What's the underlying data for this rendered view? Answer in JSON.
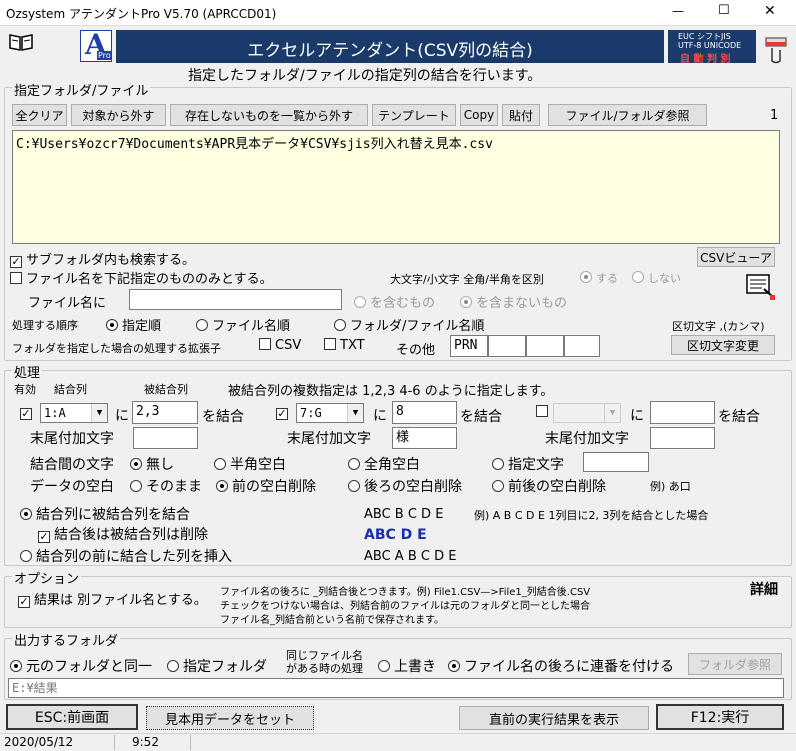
{
  "window": {
    "title": "Ozsystem アテンダントPro V5.70 (APRCCD01)",
    "controls": {
      "min": "—",
      "max": "☐",
      "close": "✕"
    }
  },
  "banner": {
    "title": "エクセルアテンダント(CSV列の結合)",
    "logo_letter": "A",
    "logo_sub": "Pro",
    "encoding_line1": "EUC  シフトJIS",
    "encoding_line2": "UTF-8 UNICODE",
    "encoding_line3": "自 動 判 別",
    "subtitle": "指定したフォルダ/ファイルの指定列の結合を行います。"
  },
  "files": {
    "group_label": "指定フォルダ/ファイル",
    "buttons": [
      "全クリア",
      "対象から外す",
      "存在しないものを一覧から外す",
      "テンプレート",
      "Copy",
      "貼付",
      "ファイル/フォルダ参照"
    ],
    "count": "1",
    "list": [
      "C:¥Users¥ozcr7¥Documents¥APR見本データ¥CSV¥sjis列入れ替え見本.csv"
    ],
    "search_subfolders": "サブフォルダ内も検索する。",
    "filename_filter": "ファイル名を下記指定のもののみとする。",
    "csv_viewer": "CSVビューア",
    "case_label": "大文字/小文字 全角/半角を区別",
    "case_yes": "する",
    "case_no": "しない",
    "filename_label": "ファイル名に",
    "filename_value": "",
    "include": "を含むもの",
    "exclude": "を含まないもの",
    "order_label": "処理する順序",
    "order_specified": "指定順",
    "order_filename": "ファイル名順",
    "order_folder": "フォルダ/ファイル名順",
    "delimiter_label": "区切文字 ,(カンマ)",
    "ext_label": "フォルダを指定した場合の処理する拡張子",
    "ext_csv": "CSV",
    "ext_txt": "TXT",
    "ext_other": "その他",
    "ext_other_values": [
      "PRN",
      "",
      "",
      ""
    ],
    "delimiter_change": "区切文字変更"
  },
  "process": {
    "group_label": "処理",
    "col_enabled": "有効",
    "col_join": "結合列",
    "col_joined": "被結合列",
    "hint": "被結合列の複数指定は  1,2,3   4-6 のように指定します。",
    "rows": [
      {
        "combo": "1:A",
        "ni": "に",
        "target": "2,3",
        "wo": "を結合",
        "suffix_label": "末尾付加文字",
        "suffix": ""
      },
      {
        "combo": "7:G",
        "ni": "に",
        "target": "8",
        "wo": "を結合",
        "suffix_label": "末尾付加文字",
        "suffix": "様"
      },
      {
        "combo": "",
        "ni": "に",
        "target": "",
        "wo": "を結合",
        "suffix_label": "末尾付加文字",
        "suffix": ""
      }
    ],
    "between_label": "結合間の文字",
    "between_none": "無し",
    "between_half": "半角空白",
    "between_full": "全角空白",
    "between_custom": "指定文字",
    "between_custom_value": "",
    "space_label": "データの空白",
    "space_keep": "そのまま",
    "space_front": "前の空白削除",
    "space_back": "後ろの空白削除",
    "space_both": "前後の空白削除",
    "space_example": "例) あ口",
    "mode_join": "結合列に被結合列を結合",
    "mode_delete": "結合後は被結合列は削除",
    "mode_insert": "結合列の前に結合した列を挿入",
    "example_1": "ABC B C D E",
    "example_note": "例) A B C D E  1列目に2, 3列を結合とした場合",
    "example_2": "ABC  D E",
    "example_3": "ABC A B C D E"
  },
  "options": {
    "group_label": "オプション",
    "separate_file": "結果は 別ファイル名とする。",
    "note_1": "ファイル名の後ろに _列結合後とつきます。例) File1.CSV—>File1_列結合後.CSV",
    "note_2": "チェックをつけない場合は、列結合前のファイルは元のフォルダと同一とした場合",
    "note_3": "ファイル名_列結合前という名前で保存されます。",
    "detail": "詳細"
  },
  "output": {
    "group_label": "出力するフォルダ",
    "same_folder": "元のフォルダと同一",
    "specified_folder": "指定フォルダ",
    "same_name_1": "同じファイル名",
    "same_name_2": "がある時の処理",
    "overwrite": "上書き",
    "append_number": "ファイル名の後ろに連番を付ける",
    "folder_browse": "フォルダ参照",
    "path": "E:¥結果"
  },
  "footer": {
    "back": "ESC:前画面",
    "sample": "見本用データをセット",
    "last_result": "直前の実行結果を表示",
    "run": "F12:実行"
  },
  "status": {
    "date": "2020/05/12",
    "time": "9:52"
  },
  "colors": {
    "banner": "#1a3a6c",
    "logo_blue": "#1f3ea8",
    "list_bg": "#ffffe1",
    "example_blue": "#1b2fb0"
  }
}
